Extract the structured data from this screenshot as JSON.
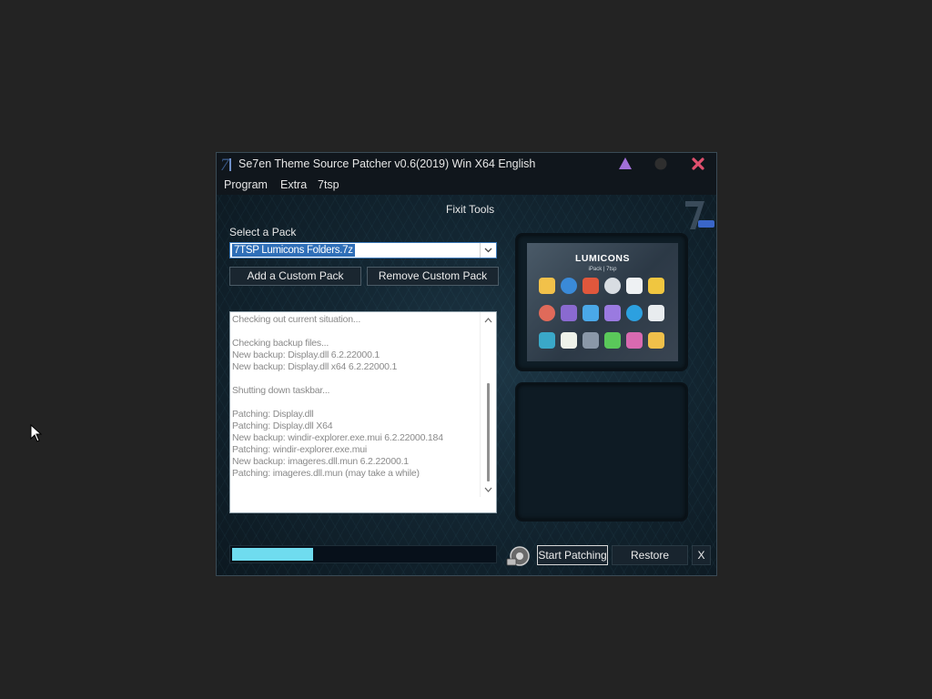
{
  "window": {
    "title": "Se7en Theme Source Patcher v0.6(2019) Win X64 English",
    "title_logo": "7tsp-logo-icon",
    "controls": [
      "help-triangle-icon",
      "minimize-icon",
      "close-icon"
    ]
  },
  "menu": {
    "items": [
      "Program",
      "Extra",
      "7tsp"
    ]
  },
  "main": {
    "fixit_label": "Fixit Tools",
    "select_label": "Select a Pack",
    "selected_pack": "7TSP Lumicons Folders.7z",
    "add_button": "Add a Custom Pack",
    "remove_button": "Remove Custom Pack",
    "log": [
      "Checking out current situation...",
      "",
      "Checking backup files...",
      "New backup: Display.dll 6.2.22000.1",
      "New backup: Display.dll x64 6.2.22000.1",
      "",
      "Shutting down taskbar...",
      "",
      "Patching: Display.dll",
      "Patching: Display.dll X64",
      "New backup: windir-explorer.exe.mui 6.2.22000.184",
      "Patching: windir-explorer.exe.mui",
      "New backup: imageres.dll.mun 6.2.22000.1",
      "Patching: imageres.dll.mun (may take a while)"
    ],
    "preview": {
      "title": "LUMICONS",
      "subtitle": "iPack | 7tsp"
    }
  },
  "footer": {
    "progress_fraction": 0.31,
    "start_button": "Start Patching",
    "restore_button": "Restore",
    "close_button": "X"
  },
  "colors": {
    "accent_progress": "#6fdcef",
    "close_red": "#e0506e",
    "help_purple": "#a270d8"
  }
}
